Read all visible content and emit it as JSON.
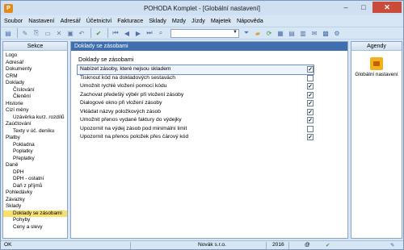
{
  "window": {
    "title": "POHODA Komplet - [Globální nastavení]",
    "app_icon": "P",
    "controls": {
      "minimize": "–",
      "maximize": "□",
      "close": "✕"
    }
  },
  "menu": [
    "Soubor",
    "Nastavení",
    "Adresář",
    "Účetnictví",
    "Fakturace",
    "Sklady",
    "Mzdy",
    "Jízdy",
    "Majetek",
    "Nápověda"
  ],
  "left_panel": {
    "title": "Sekce",
    "items": [
      {
        "label": "Logo",
        "level": 0
      },
      {
        "label": "Adresář",
        "level": 0
      },
      {
        "label": "Dokumenty",
        "level": 0
      },
      {
        "label": "CRM",
        "level": 0
      },
      {
        "label": "Doklady",
        "level": 0
      },
      {
        "label": "Číslování",
        "level": 1
      },
      {
        "label": "Členění",
        "level": 1
      },
      {
        "label": "Historie",
        "level": 0
      },
      {
        "label": "Cizí měny",
        "level": 0
      },
      {
        "label": "Uzávěrka kurz. rozdílů",
        "level": 1
      },
      {
        "label": "Zaúčtování",
        "level": 0
      },
      {
        "label": "Texty v úč. deníku",
        "level": 1
      },
      {
        "label": "Platby",
        "level": 0
      },
      {
        "label": "Pokladna",
        "level": 1
      },
      {
        "label": "Poplatky",
        "level": 1
      },
      {
        "label": "Přeplatky",
        "level": 1
      },
      {
        "label": "Daně",
        "level": 0
      },
      {
        "label": "DPH",
        "level": 1
      },
      {
        "label": "DPH - ostatní",
        "level": 1
      },
      {
        "label": "Daň z příjmů",
        "level": 1
      },
      {
        "label": "Pohledávky",
        "level": 0
      },
      {
        "label": "Závazky",
        "level": 0
      },
      {
        "label": "Sklady",
        "level": 0
      },
      {
        "label": "Doklady se zásobami",
        "level": 1,
        "selected": true
      },
      {
        "label": "Pohyby",
        "level": 1
      },
      {
        "label": "Ceny a slevy",
        "level": 1
      }
    ]
  },
  "center_panel": {
    "header": "Doklady se zásobami",
    "section_title": "Doklady se zásobami",
    "options": [
      {
        "label": "Nabízet zásoby, které nejsou skladem",
        "checked": true,
        "focused": true
      },
      {
        "label": "Tisknout kód na dokladových sestavách",
        "checked": false
      },
      {
        "label": "Umožnit rychlé vložení pomocí kódu",
        "checked": true
      },
      {
        "label": "Zachovat předešlý výběr při vložení zásoby",
        "checked": true
      },
      {
        "label": "Dialogové okno při vložení zásoby",
        "checked": true
      },
      {
        "label": "Vkládat názvy položkových zásob",
        "checked": true
      },
      {
        "label": "Umožnit přenos vydané faktury do výdejky",
        "checked": true
      },
      {
        "label": "Upozornit na výdej zásob pod minimální limit",
        "checked": false
      },
      {
        "label": "Upozornit na přenos položek přes čárový kód",
        "checked": true
      }
    ]
  },
  "right_panel": {
    "title": "Agendy",
    "agenda_label": "Globální nastavení"
  },
  "status": {
    "left": "OK",
    "company": "Novák s.r.o.",
    "year": "2016",
    "extra1": "@"
  },
  "colors": {
    "accent_header": "#3f6fae",
    "selected_item": "#f7e06f",
    "close_button": "#c94c3b"
  }
}
